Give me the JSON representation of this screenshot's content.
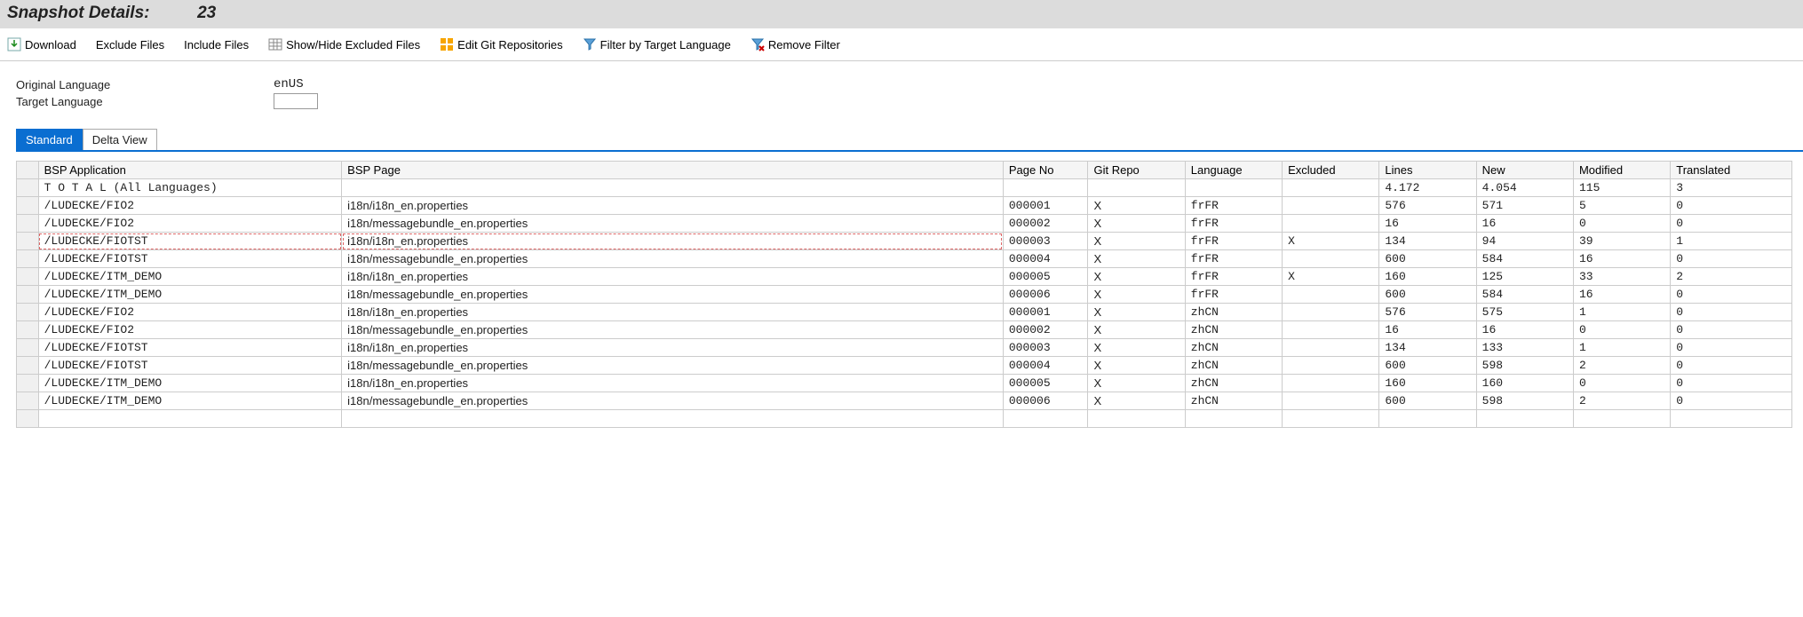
{
  "header": {
    "title": "Snapshot Details:",
    "number": "23"
  },
  "toolbar": {
    "download": "Download",
    "exclude": "Exclude Files",
    "include": "Include Files",
    "showhide": "Show/Hide Excluded Files",
    "editgit": "Edit Git Repositories",
    "filter": "Filter by Target Language",
    "removefilter": "Remove Filter"
  },
  "form": {
    "orig_label": "Original Language",
    "orig_value": "enUS",
    "tgt_label": "Target Language",
    "tgt_value": ""
  },
  "tabs": {
    "standard": "Standard",
    "delta": "Delta View"
  },
  "columns": {
    "app": "BSP Application",
    "page": "BSP Page",
    "pn": "Page No",
    "git": "Git Repo",
    "lang": "Language",
    "excl": "Excluded",
    "lines": "Lines",
    "new": "New",
    "mod": "Modified",
    "trans": "Translated"
  },
  "total_label": "T O T A L  (All Languages)",
  "totals": {
    "lines": "4.172",
    "new": "4.054",
    "mod": "115",
    "trans": "3"
  },
  "rows": [
    {
      "app": "/LUDECKE/FIO2",
      "page": "i18n/i18n_en.properties",
      "pn": "000001",
      "git": "X",
      "lang": "frFR",
      "excl": "",
      "lines": "576",
      "new": "571",
      "mod": "5",
      "trans": "0"
    },
    {
      "app": "/LUDECKE/FIO2",
      "page": "i18n/messagebundle_en.properties",
      "pn": "000002",
      "git": "X",
      "lang": "frFR",
      "excl": "",
      "lines": "16",
      "new": "16",
      "mod": "0",
      "trans": "0"
    },
    {
      "app": "/LUDECKE/FIOTST",
      "page": "i18n/i18n_en.properties",
      "pn": "000003",
      "git": "X",
      "lang": "frFR",
      "excl": "X",
      "lines": "134",
      "new": "94",
      "mod": "39",
      "trans": "1",
      "selected": true
    },
    {
      "app": "/LUDECKE/FIOTST",
      "page": "i18n/messagebundle_en.properties",
      "pn": "000004",
      "git": "X",
      "lang": "frFR",
      "excl": "",
      "lines": "600",
      "new": "584",
      "mod": "16",
      "trans": "0"
    },
    {
      "app": "/LUDECKE/ITM_DEMO",
      "page": "i18n/i18n_en.properties",
      "pn": "000005",
      "git": "X",
      "lang": "frFR",
      "excl": "X",
      "lines": "160",
      "new": "125",
      "mod": "33",
      "trans": "2"
    },
    {
      "app": "/LUDECKE/ITM_DEMO",
      "page": "i18n/messagebundle_en.properties",
      "pn": "000006",
      "git": "X",
      "lang": "frFR",
      "excl": "",
      "lines": "600",
      "new": "584",
      "mod": "16",
      "trans": "0"
    },
    {
      "app": "/LUDECKE/FIO2",
      "page": "i18n/i18n_en.properties",
      "pn": "000001",
      "git": "X",
      "lang": "zhCN",
      "excl": "",
      "lines": "576",
      "new": "575",
      "mod": "1",
      "trans": "0"
    },
    {
      "app": "/LUDECKE/FIO2",
      "page": "i18n/messagebundle_en.properties",
      "pn": "000002",
      "git": "X",
      "lang": "zhCN",
      "excl": "",
      "lines": "16",
      "new": "16",
      "mod": "0",
      "trans": "0"
    },
    {
      "app": "/LUDECKE/FIOTST",
      "page": "i18n/i18n_en.properties",
      "pn": "000003",
      "git": "X",
      "lang": "zhCN",
      "excl": "",
      "lines": "134",
      "new": "133",
      "mod": "1",
      "trans": "0"
    },
    {
      "app": "/LUDECKE/FIOTST",
      "page": "i18n/messagebundle_en.properties",
      "pn": "000004",
      "git": "X",
      "lang": "zhCN",
      "excl": "",
      "lines": "600",
      "new": "598",
      "mod": "2",
      "trans": "0"
    },
    {
      "app": "/LUDECKE/ITM_DEMO",
      "page": "i18n/i18n_en.properties",
      "pn": "000005",
      "git": "X",
      "lang": "zhCN",
      "excl": "",
      "lines": "160",
      "new": "160",
      "mod": "0",
      "trans": "0"
    },
    {
      "app": "/LUDECKE/ITM_DEMO",
      "page": "i18n/messagebundle_en.properties",
      "pn": "000006",
      "git": "X",
      "lang": "zhCN",
      "excl": "",
      "lines": "600",
      "new": "598",
      "mod": "2",
      "trans": "0"
    }
  ]
}
